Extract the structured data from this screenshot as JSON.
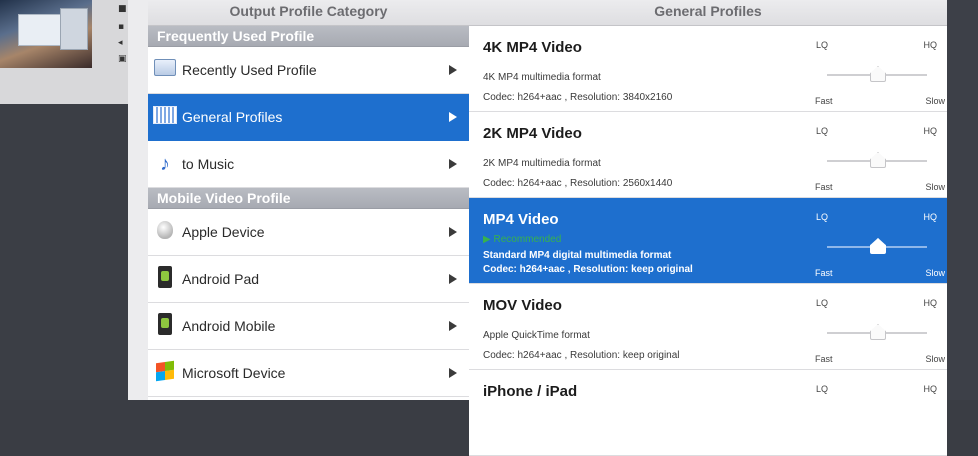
{
  "category_panel": {
    "header": "Output Profile Category",
    "groups": [
      {
        "title": "Frequently Used Profile",
        "items": [
          {
            "label": "Recently Used Profile",
            "icon": "recent-icon"
          },
          {
            "label": "General Profiles",
            "icon": "profiles-icon",
            "selected": true
          },
          {
            "label": "to Music",
            "icon": "music-note-icon"
          }
        ]
      },
      {
        "title": "Mobile Video Profile",
        "items": [
          {
            "label": "Apple Device",
            "icon": "apple-icon"
          },
          {
            "label": "Android Pad",
            "icon": "android-icon"
          },
          {
            "label": "Android Mobile",
            "icon": "android-icon"
          },
          {
            "label": "Microsoft Device",
            "icon": "windows-icon"
          }
        ]
      }
    ]
  },
  "general_panel": {
    "header": "General Profiles",
    "quality_labels": {
      "lq": "LQ",
      "hq": "HQ",
      "fast": "Fast",
      "slow": "Slow"
    },
    "profiles": [
      {
        "name": "4K MP4 Video",
        "description": "4K MP4 multimedia format",
        "codec": "Codec: h264+aac , Resolution: 3840x2160",
        "quality": 0.5
      },
      {
        "name": "2K MP4 Video",
        "description": "2K MP4 multimedia format",
        "codec": "Codec: h264+aac , Resolution: 2560x1440",
        "quality": 0.5
      },
      {
        "name": "MP4 Video",
        "recommended": "▶ Recommended",
        "description": "Standard MP4 digital multimedia format",
        "codec": "Codec: h264+aac , Resolution: keep original",
        "quality": 0.5,
        "selected": true
      },
      {
        "name": "MOV Video",
        "description": "Apple QuickTime format",
        "codec": "Codec: h264+aac , Resolution: keep original",
        "quality": 0.5
      },
      {
        "name": "iPhone / iPad",
        "description": "",
        "codec": "",
        "quality": 0.5
      }
    ]
  },
  "colors": {
    "selection": "#1e6fce",
    "recommended": "#37b24d"
  }
}
